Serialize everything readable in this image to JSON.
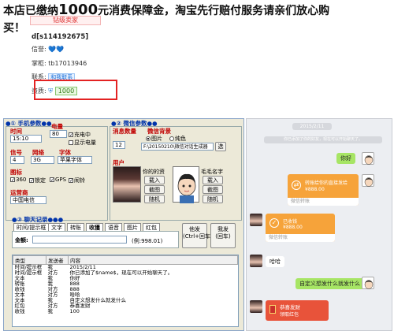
{
  "notice": {
    "line1_pre": "本店已缴纳",
    "amount": "1000",
    "line1_post": "元消费保障金，淘宝先行赔付服务请亲们放心购",
    "line2": "买！"
  },
  "shop": {
    "ribbon": "钻级卖家",
    "uid": "d[s114192675]",
    "credit_label": "信誉:",
    "credit_value": "💙💙",
    "owner_label": "掌柜:",
    "owner_value": "tb17013946",
    "contact_label": "联系:",
    "contact_value": "和我联系",
    "qual_label": "资质:",
    "qual_value": "1000"
  },
  "tool": {
    "phone_group": "●① 手机参数●●",
    "time_label": "时间",
    "time_value": "15:10",
    "battery_label": "电量",
    "battery_value": "80",
    "charging": "充电中",
    "show_battery": "显示电量",
    "signal_label": "信号",
    "signal_value": "4",
    "network_label": "网络",
    "network_value": "3G",
    "font_label": "字体",
    "font_value": "苹果字体",
    "icons_label": "图标",
    "icons": [
      "360",
      "锁定",
      "GPS",
      "闹铃"
    ],
    "carrier_label": "运营商",
    "carrier_value": "中国电信",
    "wechat_group": "●② 微信参数●●",
    "msg_count_label": "消息数量",
    "msg_count_value": "12",
    "bg_label": "微信背景",
    "bg_opt_image": "图片",
    "bg_opt_pure": "纯色",
    "bg_path": "F:\\20150210\\微信对话生成器",
    "bg_select": "选",
    "user_label": "用户",
    "your_profile": "你的的资",
    "my_profile": "毛毛名字",
    "load": "载入",
    "cut": "截图",
    "random": "随机",
    "chat_group": "●③ 聊天记录●●●",
    "tabs": [
      "时间/提示框",
      "文字",
      "转账",
      "收獲",
      "语音",
      "图片",
      "红包"
    ],
    "amount_label": "金额:",
    "amount_hint": "(例:998.01)",
    "btn_he": "他发",
    "btn_he2": "(Ctrl+回车)",
    "btn_me": "我发",
    "btn_me2": "(回车)",
    "log_headers": [
      "类型",
      "发送者",
      "内容"
    ],
    "log_rows": [
      [
        "时间/提示框",
        "我",
        "2015/2/11"
      ],
      [
        "时间/提示框",
        "对方",
        "你已添加了$name$，现在可以开始聊天了。"
      ],
      [
        "文本",
        "我",
        "你好"
      ],
      [
        "转账",
        "我",
        "888"
      ],
      [
        "收钱",
        "对方",
        "888"
      ],
      [
        "文本",
        "对方",
        "哈哈"
      ],
      [
        "文本",
        "我",
        "自定义想发什么就发什么"
      ],
      [
        "红包",
        "对方",
        "恭喜发财"
      ],
      [
        "收钱",
        "我",
        "100"
      ]
    ]
  },
  "chat": {
    "time_pill": "2015/2/11",
    "system_tip": "你已添加了你的好友，现在可以开始聊天了。",
    "msg_hello": "你好",
    "transfer_out_title": "转账给你的直接发给",
    "transfer_out_amount": "¥888.00",
    "transfer_out_foot": "微信转账",
    "transfer_in_title": "已收钱",
    "transfer_in_amount": "¥888.00",
    "transfer_in_foot": "微信转账",
    "msg_haha": "哈哈",
    "msg_custom": "自定义想发什么就发什么",
    "redpack_title": "恭喜发财",
    "redpack_sub": "领取红包",
    "colors": {
      "green_bubble": "#a7e565",
      "transfer": "#f6a33a",
      "redpack": "#e8533a"
    }
  }
}
